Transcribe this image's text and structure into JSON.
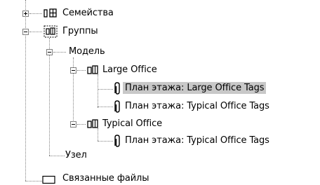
{
  "tree": {
    "families": {
      "label": "Семейства",
      "icon": "families-icon",
      "expander": "plus"
    },
    "groups": {
      "label": "Группы",
      "icon": "groups-icon",
      "expander": "minus",
      "model": {
        "label": "Модель",
        "expander": "minus",
        "large_office": {
          "label": "Large Office",
          "icon": "group-type-icon",
          "expander": "minus",
          "items": [
            {
              "label": "План этажа: Large Office Tags",
              "icon": "paperclip-icon",
              "selected": true
            },
            {
              "label": "План этажа: Typical Office Tags",
              "icon": "paperclip-icon",
              "selected": false
            }
          ]
        },
        "typical_office": {
          "label": "Typical Office",
          "icon": "group-type-icon",
          "expander": "minus",
          "items": [
            {
              "label": "План этажа: Typical Office Tags",
              "icon": "paperclip-icon",
              "selected": false
            }
          ]
        }
      },
      "node": {
        "label": "Узел"
      }
    },
    "linked_files": {
      "label": "Связанные файлы",
      "icon": "linked-file-icon"
    }
  },
  "colors": {
    "selection": "#c8c8c8",
    "connector": "#808080"
  }
}
